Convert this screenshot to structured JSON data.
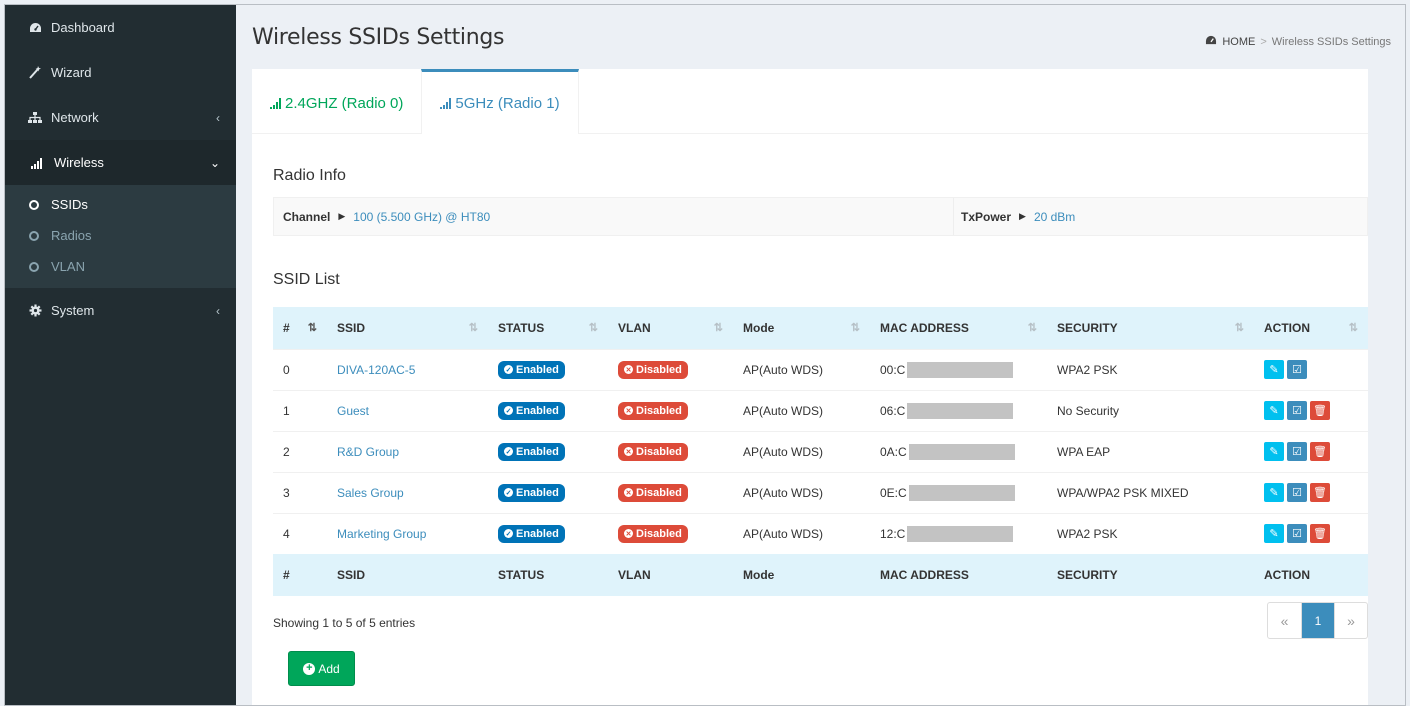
{
  "sidebar": {
    "items": [
      {
        "label": "Dashboard",
        "icon": "dashboard-icon"
      },
      {
        "label": "Wizard",
        "icon": "wand-icon"
      },
      {
        "label": "Network",
        "icon": "sitemap-icon"
      },
      {
        "label": "Wireless",
        "icon": "signal-icon"
      },
      {
        "label": "System",
        "icon": "gear-icon"
      }
    ],
    "wireless_sub": [
      "SSIDs",
      "Radios",
      "VLAN"
    ]
  },
  "header": {
    "title": "Wireless SSIDs Settings",
    "breadcrumb_home": "HOME",
    "breadcrumb_current": "Wireless SSIDs Settings"
  },
  "tabs": [
    {
      "label": "2.4GHZ (Radio 0)"
    },
    {
      "label": "5GHz (Radio 1)"
    }
  ],
  "radio_info": {
    "title": "Radio Info",
    "channel_label": "Channel",
    "channel_value": "100 (5.500 GHz) @ HT80",
    "txpower_label": "TxPower",
    "txpower_value": "20 dBm"
  },
  "ssid_list": {
    "title": "SSID List",
    "columns": [
      "#",
      "SSID",
      "STATUS",
      "VLAN",
      "Mode",
      "MAC ADDRESS",
      "SECURITY",
      "ACTION"
    ],
    "rows": [
      {
        "num": "0",
        "ssid": "DIVA-120AC-5",
        "status": "Enabled",
        "vlan": "Disabled",
        "mode": "AP(Auto WDS)",
        "mac": "00:C",
        "security": "WPA2 PSK"
      },
      {
        "num": "1",
        "ssid": "Guest",
        "status": "Enabled",
        "vlan": "Disabled",
        "mode": "AP(Auto WDS)",
        "mac": "06:C",
        "security": "No Security"
      },
      {
        "num": "2",
        "ssid": "R&D Group",
        "status": "Enabled",
        "vlan": "Disabled",
        "mode": "AP(Auto WDS)",
        "mac": "0A:C",
        "security": "WPA EAP"
      },
      {
        "num": "3",
        "ssid": "Sales Group",
        "status": "Enabled",
        "vlan": "Disabled",
        "mode": "AP(Auto WDS)",
        "mac": "0E:C",
        "security": "WPA/WPA2 PSK MIXED"
      },
      {
        "num": "4",
        "ssid": "Marketing Group",
        "status": "Enabled",
        "vlan": "Disabled",
        "mode": "AP(Auto WDS)",
        "mac": "12:C",
        "security": "WPA2 PSK"
      }
    ],
    "showing": "Showing 1 to 5 of 5 entries",
    "pager": {
      "prev": "«",
      "current": "1",
      "next": "»"
    },
    "add_label": "Add"
  },
  "colors": {
    "sidebar_bg": "#222d32",
    "accent_blue": "#3c8dbc",
    "green": "#00a65a",
    "red": "#dd4b39",
    "header_row": "#dff3fb"
  }
}
